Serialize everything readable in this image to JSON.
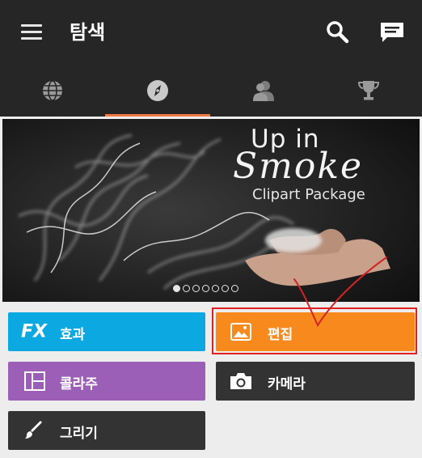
{
  "header": {
    "title": "탐색",
    "icons": [
      "menu-icon",
      "search-icon",
      "chat-icon"
    ]
  },
  "tabs": [
    {
      "icon": "globe-icon",
      "active": false
    },
    {
      "icon": "compass-icon",
      "active": true
    },
    {
      "icon": "person-icon",
      "active": false
    },
    {
      "icon": "trophy-icon",
      "active": false
    }
  ],
  "banner": {
    "line1": "Up in",
    "line2": "Smoke",
    "line3": "Clipart Package",
    "slides": 7,
    "active_slide": 1
  },
  "tiles": {
    "effects": {
      "icon_text": "FX",
      "label": "효과"
    },
    "edit": {
      "label": "편집"
    },
    "collage": {
      "label": "콜라주"
    },
    "camera": {
      "label": "카메라"
    },
    "draw": {
      "label": "그리기"
    }
  },
  "colors": {
    "appbar": "#262626",
    "tab_indicator": "#f07a42",
    "effects": "#0ba8e2",
    "edit": "#f8891c",
    "collage": "#9b5fb7",
    "dark_tile": "#333333",
    "annotation": "#e02020"
  }
}
